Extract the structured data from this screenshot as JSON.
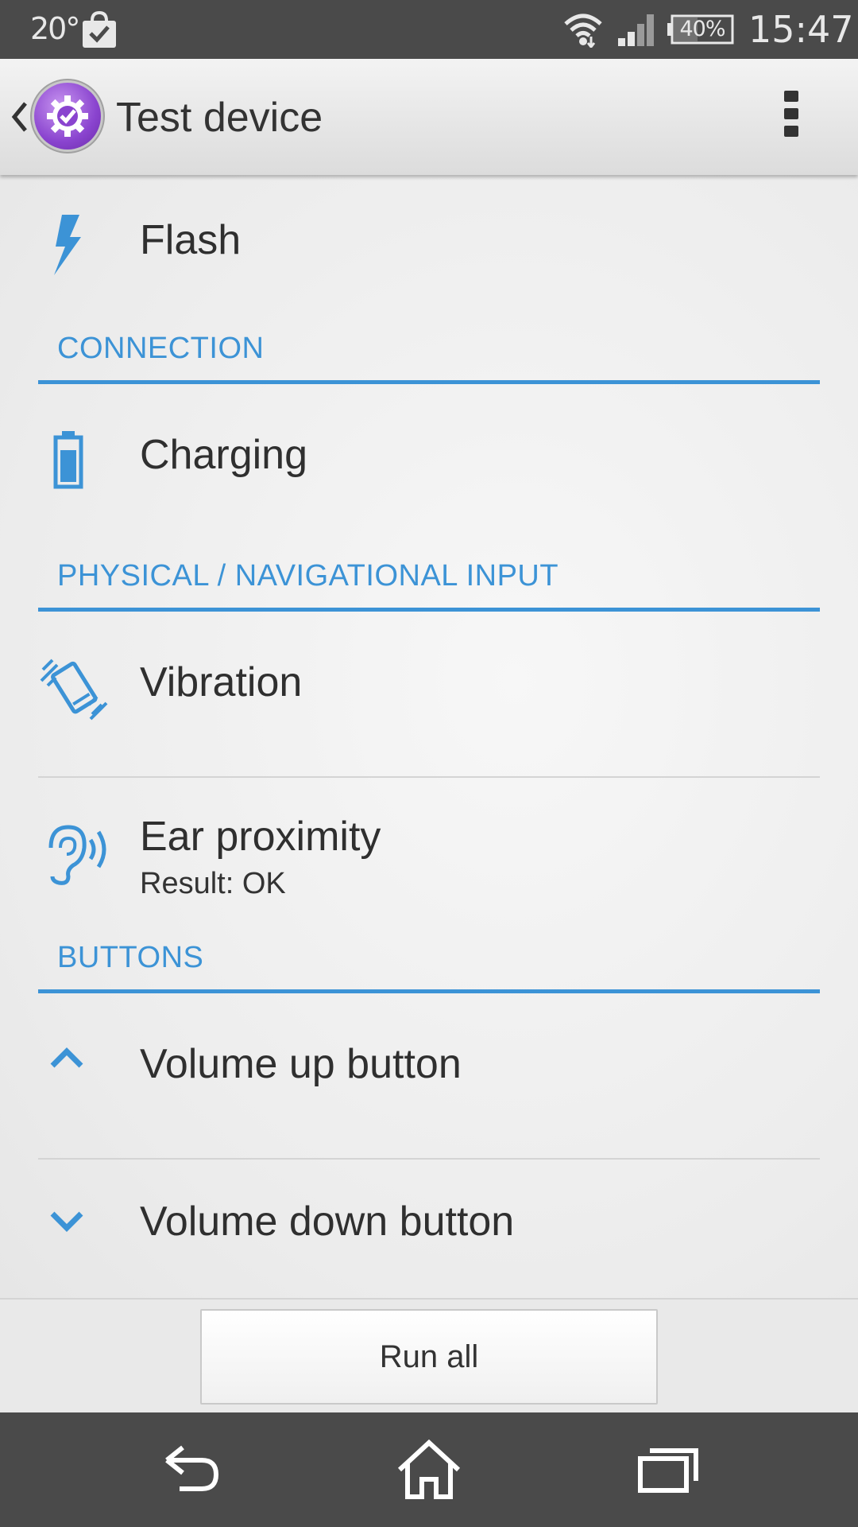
{
  "status_bar": {
    "temperature": "20°",
    "battery_percent": "40%",
    "time": "15:47",
    "icons": [
      "shopping-bag-check-icon",
      "wifi-icon",
      "signal-icon",
      "battery-icon"
    ]
  },
  "action_bar": {
    "title": "Test device",
    "icons": [
      "back-caret-icon",
      "app-icon",
      "overflow-menu-icon"
    ]
  },
  "colors": {
    "accent": "#3c93d6",
    "status_bar_bg": "#4a4a4a",
    "nav_bar_bg": "#4a4a4a"
  },
  "list": {
    "flash": {
      "label": "Flash",
      "icon": "flash-icon"
    },
    "connection_header": "CONNECTION",
    "charging": {
      "label": "Charging",
      "icon": "battery-charging-icon"
    },
    "physical_header": "PHYSICAL / NAVIGATIONAL INPUT",
    "vibration": {
      "label": "Vibration",
      "icon": "vibration-icon"
    },
    "ear_proximity": {
      "label": "Ear proximity",
      "result": "Result: OK",
      "icon": "ear-icon"
    },
    "buttons_header": "BUTTONS",
    "volume_up": {
      "label": "Volume up button",
      "icon": "chevron-up-icon"
    },
    "volume_down": {
      "label": "Volume down button",
      "icon": "chevron-down-icon"
    }
  },
  "footer": {
    "run_all_label": "Run all"
  },
  "nav_bar": {
    "icons": [
      "back-icon",
      "home-icon",
      "recent-apps-icon"
    ]
  }
}
